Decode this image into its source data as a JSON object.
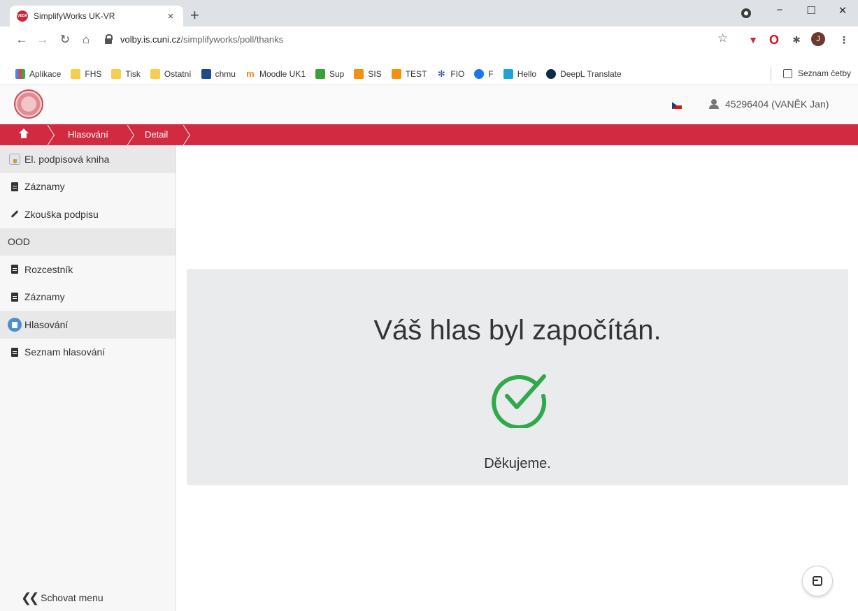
{
  "browser": {
    "tab_title": "SimplifyWorks UK-VR",
    "tab_favicon_text": "VEDA",
    "tab_close": "×",
    "new_tab": "+",
    "url_host": "volby.is.cuni.cz",
    "url_path": "/simplifyworks/poll/thanks",
    "window_min": "−",
    "window_max": "☐",
    "window_close": "✕",
    "avatar_letter": "J",
    "bookmarks": [
      {
        "label": "Aplikace",
        "icon": "apps-grid-icon"
      },
      {
        "label": "FHS",
        "icon": "folder-icon"
      },
      {
        "label": "Tisk",
        "icon": "folder-icon"
      },
      {
        "label": "Ostatní",
        "icon": "folder-icon"
      },
      {
        "label": "chmu",
        "icon": "chmu-icon"
      },
      {
        "label": "Moodle UK1",
        "icon": "moodle-icon"
      },
      {
        "label": "Sup",
        "icon": "sup-icon"
      },
      {
        "label": "SIS",
        "icon": "sis-icon"
      },
      {
        "label": "TEST",
        "icon": "sis-icon"
      },
      {
        "label": "FIO",
        "icon": "fio-icon"
      },
      {
        "label": "F",
        "icon": "facebook-icon"
      },
      {
        "label": "Hello",
        "icon": "hello-icon"
      },
      {
        "label": "DeepL Translate",
        "icon": "deepl-icon"
      }
    ],
    "reading_list": "Seznam četby"
  },
  "header": {
    "user_label": "45296404 (VANĚK Jan)"
  },
  "breadcrumb": {
    "items": [
      "Hlasování",
      "Detail"
    ]
  },
  "sidebar": {
    "items": [
      {
        "label": "El. podpisová kniha",
        "type": "head",
        "icon": "signature-book-icon"
      },
      {
        "label": "Záznamy",
        "type": "item",
        "icon": "document-icon"
      },
      {
        "label": "Zkouška podpisu",
        "type": "item",
        "icon": "pencil-icon"
      },
      {
        "label": "OOD",
        "type": "head",
        "icon": ""
      },
      {
        "label": "Rozcestník",
        "type": "item",
        "icon": "document-icon"
      },
      {
        "label": "Záznamy",
        "type": "item",
        "icon": "document-icon"
      },
      {
        "label": "Hlasování",
        "type": "head",
        "icon": "ballot-box-icon"
      },
      {
        "label": "Seznam hlasování",
        "type": "item",
        "icon": "document-icon"
      }
    ],
    "hide_menu": "Schovat menu"
  },
  "main": {
    "title": "Váš hlas byl započítán.",
    "thanks": "Děkujeme."
  },
  "colors": {
    "brand_red": "#d22a40",
    "success_green": "#2eaa4a",
    "panel_bg": "#e9ebed"
  }
}
